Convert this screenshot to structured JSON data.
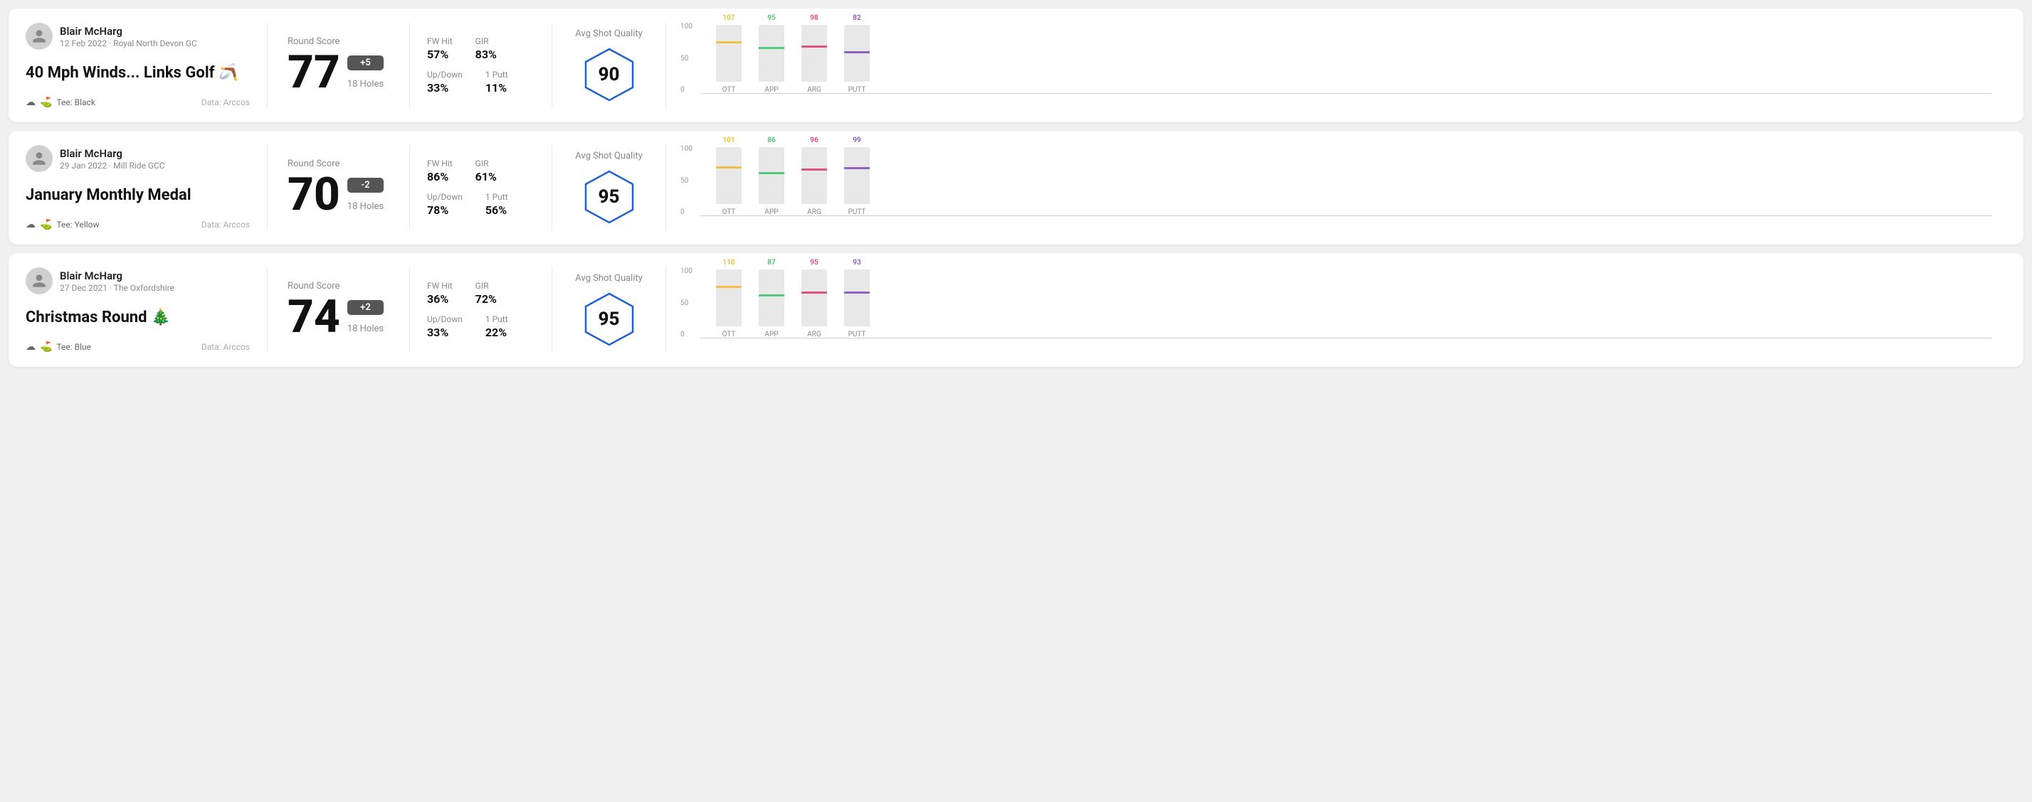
{
  "rounds": [
    {
      "id": "round-1",
      "player_name": "Blair McHarg",
      "date": "12 Feb 2022 · Royal North Devon GC",
      "title": "40 Mph Winds... Links Golf",
      "title_emoji": "🪃",
      "tee": "Black",
      "data_source": "Data: Arccos",
      "score": "77",
      "score_diff": "+5",
      "score_diff_sign": "plus",
      "holes": "18 Holes",
      "fw_hit": "57%",
      "gir": "83%",
      "up_down": "33%",
      "one_putt": "11%",
      "avg_shot_quality": "90",
      "chart": {
        "ott": {
          "value": 107,
          "color": "#f0c040",
          "height_pct": 72
        },
        "app": {
          "value": 95,
          "color": "#50c878",
          "height_pct": 63
        },
        "arg": {
          "value": 98,
          "color": "#e05080",
          "height_pct": 65
        },
        "putt": {
          "value": 82,
          "color": "#9060c0",
          "height_pct": 55
        }
      }
    },
    {
      "id": "round-2",
      "player_name": "Blair McHarg",
      "date": "29 Jan 2022 · Mill Ride GCC",
      "title": "January Monthly Medal",
      "title_emoji": "",
      "tee": "Yellow",
      "data_source": "Data: Arccos",
      "score": "70",
      "score_diff": "-2",
      "score_diff_sign": "minus",
      "holes": "18 Holes",
      "fw_hit": "86%",
      "gir": "61%",
      "up_down": "78%",
      "one_putt": "56%",
      "avg_shot_quality": "95",
      "chart": {
        "ott": {
          "value": 101,
          "color": "#f0c040",
          "height_pct": 67
        },
        "app": {
          "value": 86,
          "color": "#50c878",
          "height_pct": 57
        },
        "arg": {
          "value": 96,
          "color": "#e05080",
          "height_pct": 64
        },
        "putt": {
          "value": 99,
          "color": "#9060c0",
          "height_pct": 66
        }
      }
    },
    {
      "id": "round-3",
      "player_name": "Blair McHarg",
      "date": "27 Dec 2021 · The Oxfordshire",
      "title": "Christmas Round",
      "title_emoji": "🎄",
      "tee": "Blue",
      "data_source": "Data: Arccos",
      "score": "74",
      "score_diff": "+2",
      "score_diff_sign": "plus",
      "holes": "18 Holes",
      "fw_hit": "36%",
      "gir": "72%",
      "up_down": "33%",
      "one_putt": "22%",
      "avg_shot_quality": "95",
      "chart": {
        "ott": {
          "value": 110,
          "color": "#f0c040",
          "height_pct": 73
        },
        "app": {
          "value": 87,
          "color": "#50c878",
          "height_pct": 58
        },
        "arg": {
          "value": 95,
          "color": "#e05080",
          "height_pct": 63
        },
        "putt": {
          "value": 93,
          "color": "#9060c0",
          "height_pct": 62
        }
      }
    }
  ],
  "chart_labels": {
    "ott": "OTT",
    "app": "APP",
    "arg": "ARG",
    "putt": "PUTT"
  },
  "chart_y_labels": [
    "100",
    "50",
    "0"
  ]
}
